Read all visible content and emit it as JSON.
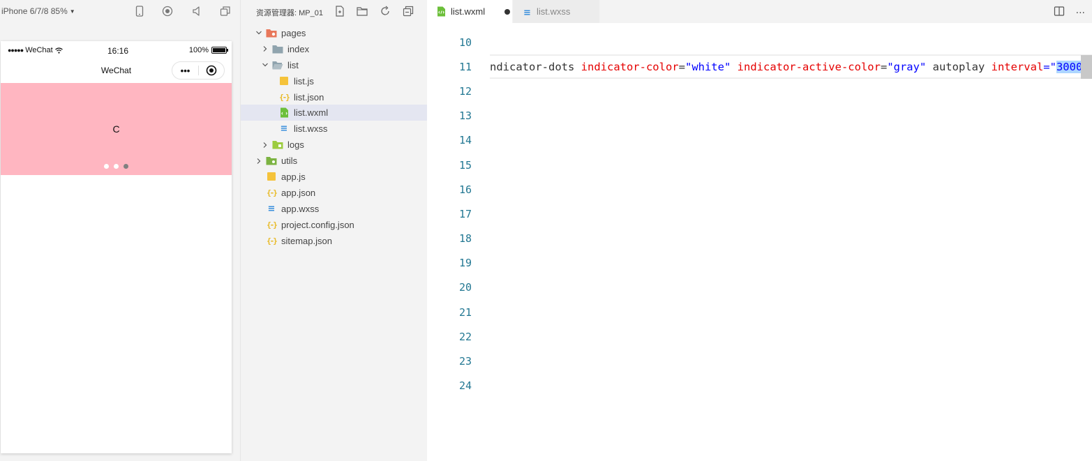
{
  "simulator": {
    "device_label": "iPhone 6/7/8 85%",
    "status": {
      "carrier": "WeChat",
      "time": "16:16",
      "battery": "100%"
    },
    "nav_title": "WeChat",
    "swiper_text": "C",
    "swiper_color": "#ffb6c1",
    "dots": [
      {
        "color": "#ffffff",
        "active": false
      },
      {
        "color": "#ffffff",
        "active": false
      },
      {
        "color": "#808080",
        "active": true
      }
    ]
  },
  "explorer": {
    "title": "资源管理器: MP_01",
    "tree": [
      {
        "label": "pages",
        "level": 0,
        "chevron": "down",
        "icon": "folder-pages-icon"
      },
      {
        "label": "index",
        "level": 1,
        "chevron": "right",
        "icon": "folder-icon"
      },
      {
        "label": "list",
        "level": 1,
        "chevron": "down",
        "icon": "folder-open-icon"
      },
      {
        "label": "list.js",
        "level": 2,
        "chevron": "none",
        "icon": "js-file-icon"
      },
      {
        "label": "list.json",
        "level": 2,
        "chevron": "none",
        "icon": "json-file-icon"
      },
      {
        "label": "list.wxml",
        "level": 2,
        "chevron": "none",
        "icon": "wxml-file-icon",
        "selected": true
      },
      {
        "label": "list.wxss",
        "level": 2,
        "chevron": "none",
        "icon": "wxss-file-icon"
      },
      {
        "label": "logs",
        "level": 1,
        "chevron": "right",
        "icon": "folder-logs-icon"
      },
      {
        "label": "utils",
        "level": 0,
        "chevron": "right",
        "icon": "folder-utils-icon"
      },
      {
        "label": "app.js",
        "level": 0,
        "chevron": "none",
        "icon": "js-file-icon"
      },
      {
        "label": "app.json",
        "level": 0,
        "chevron": "none",
        "icon": "json-file-icon"
      },
      {
        "label": "app.wxss",
        "level": 0,
        "chevron": "none",
        "icon": "wxss-file-icon"
      },
      {
        "label": "project.config.json",
        "level": 0,
        "chevron": "none",
        "icon": "json-file-icon"
      },
      {
        "label": "sitemap.json",
        "level": 0,
        "chevron": "none",
        "icon": "json-file-icon"
      }
    ]
  },
  "editor": {
    "tabs": [
      {
        "label": "list.wxml",
        "active": true,
        "dirty": true
      },
      {
        "label": "list.wxss",
        "active": false,
        "dirty": false
      }
    ],
    "line_numbers": [
      "10",
      "11",
      "12",
      "13",
      "14",
      "15",
      "16",
      "17",
      "18",
      "19",
      "20",
      "21",
      "22",
      "23",
      "24"
    ],
    "line_11_tokens": [
      {
        "text": "ndicator-dots ",
        "kind": "plain"
      },
      {
        "text": "indicator-color",
        "kind": "attr"
      },
      {
        "text": "=",
        "kind": "plain"
      },
      {
        "text": "\"white\"",
        "kind": "str"
      },
      {
        "text": " ",
        "kind": "plain"
      },
      {
        "text": "indicator-active-color",
        "kind": "attr"
      },
      {
        "text": "=",
        "kind": "plain"
      },
      {
        "text": "\"gray\"",
        "kind": "str"
      },
      {
        "text": " autoplay ",
        "kind": "plain"
      },
      {
        "text": "interval",
        "kind": "attr"
      },
      {
        "text": "=\"",
        "kind": "str"
      },
      {
        "text": "3000",
        "kind": "sel"
      },
      {
        "text": ">",
        "kind": "sel-plain"
      }
    ]
  }
}
